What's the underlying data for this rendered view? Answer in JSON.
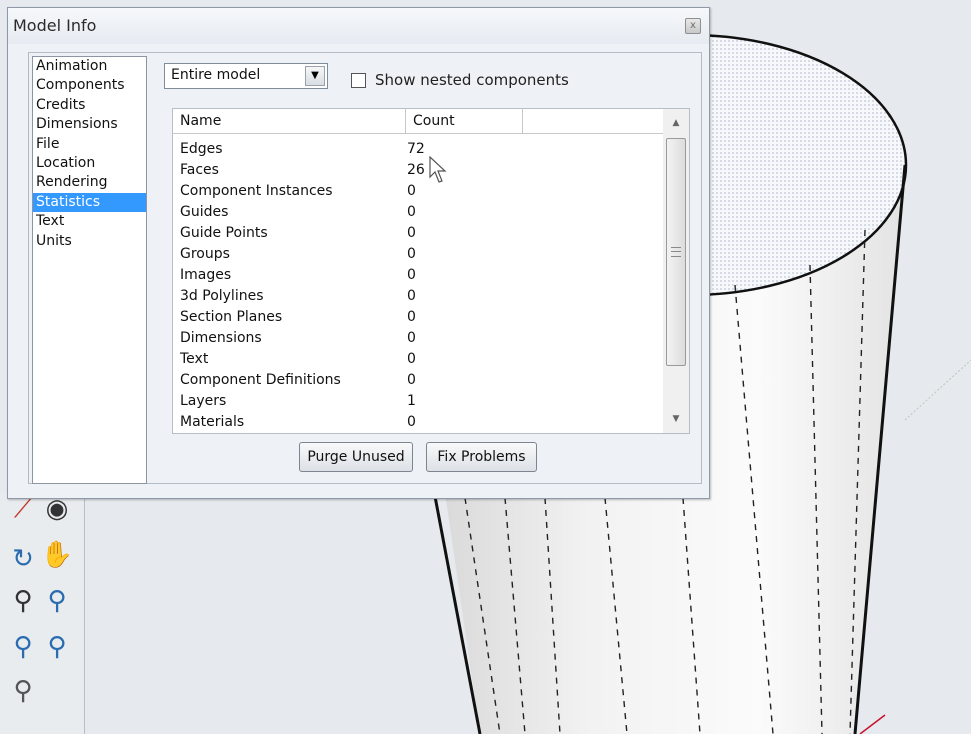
{
  "dialog": {
    "title": "Model Info",
    "close_label": "x"
  },
  "nav": {
    "items": [
      {
        "label": "Animation"
      },
      {
        "label": "Components"
      },
      {
        "label": "Credits"
      },
      {
        "label": "Dimensions"
      },
      {
        "label": "File"
      },
      {
        "label": "Location"
      },
      {
        "label": "Rendering"
      },
      {
        "label": "Statistics",
        "selected": true
      },
      {
        "label": "Text"
      },
      {
        "label": "Units"
      }
    ]
  },
  "filter": {
    "scope_value": "Entire model",
    "show_nested_label": "Show nested components",
    "show_nested_checked": false
  },
  "table": {
    "columns": [
      "Name",
      "Count"
    ],
    "rows": [
      {
        "name": "Edges",
        "count": "72"
      },
      {
        "name": "Faces",
        "count": "26"
      },
      {
        "name": "Component Instances",
        "count": "0"
      },
      {
        "name": "Guides",
        "count": "0"
      },
      {
        "name": "Guide Points",
        "count": "0"
      },
      {
        "name": "Groups",
        "count": "0"
      },
      {
        "name": "Images",
        "count": "0"
      },
      {
        "name": "3d Polylines",
        "count": "0"
      },
      {
        "name": "Section Planes",
        "count": "0"
      },
      {
        "name": "Dimensions",
        "count": "0"
      },
      {
        "name": "Text",
        "count": "0"
      },
      {
        "name": "Component Definitions",
        "count": "0"
      },
      {
        "name": "Layers",
        "count": "1"
      },
      {
        "name": "Materials",
        "count": "0"
      }
    ]
  },
  "buttons": {
    "purge_label": "Purge Unused",
    "fix_label": "Fix Problems"
  },
  "colors": {
    "selection": "#3399ff",
    "viewport_bg": "#e6eaee"
  },
  "icons": [
    "close-icon",
    "dropdown-arrow-icon",
    "scroll-up-icon",
    "scroll-down-icon",
    "mouse-cursor-icon",
    "orbit-tool-icon",
    "pan-tool-icon",
    "zoom-tool-icon",
    "zoom-window-icon",
    "walk-tool-icon",
    "look-around-icon"
  ]
}
